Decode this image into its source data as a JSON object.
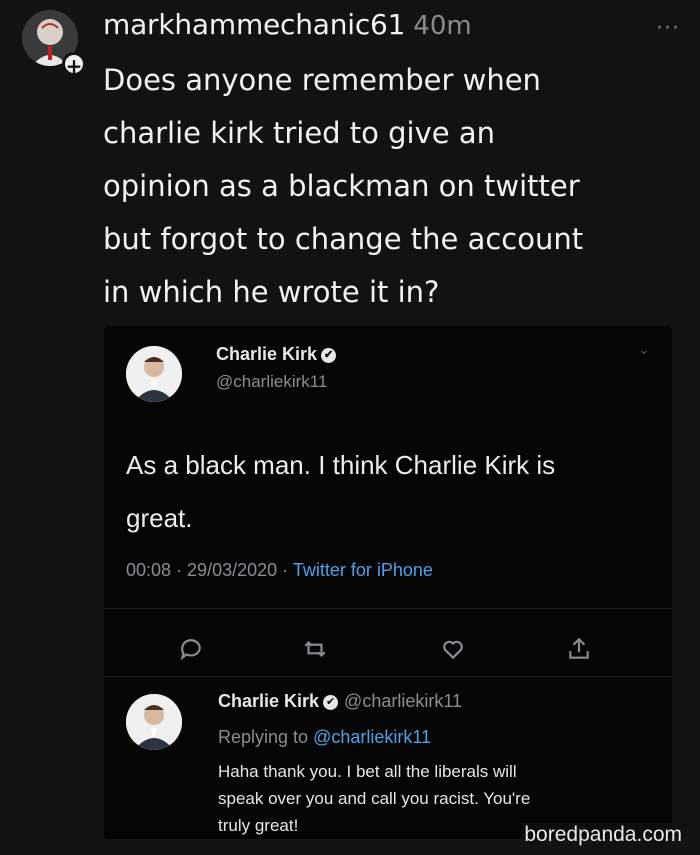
{
  "post": {
    "username": "markhammechanic61",
    "time_ago": "40m",
    "more": "···",
    "plus": "+",
    "body_lines": [
      "Does anyone remember when",
      "charlie kirk tried to give an",
      "opinion as a blackman on twitter",
      "but forgot to change the account",
      "in which he wrote it in?"
    ]
  },
  "tweet": {
    "name": "Charlie Kirk",
    "handle": "@charliekirk11",
    "text_lines": [
      "As a black man. I think Charlie Kirk is",
      "great."
    ],
    "time": "00:08",
    "date": "29/03/2020",
    "source": "Twitter for iPhone",
    "separator": " · "
  },
  "reply": {
    "name": "Charlie Kirk",
    "handle": "@charliekirk11",
    "replying_label": "Replying to",
    "replying_to": "@charliekirk11",
    "text_lines": [
      "Haha thank you. I bet all the liberals will",
      "speak over you and call you racist. You're",
      "truly great!"
    ]
  },
  "icons": {
    "verified": "✔",
    "chevron": "⌄",
    "reply": "reply-icon",
    "retweet": "retweet-icon",
    "like": "heart-icon",
    "share": "share-icon"
  },
  "watermark": "boredpanda.com",
  "colors": {
    "background": "#121212",
    "card": "#050505",
    "link": "#4aa3e8",
    "muted": "#8a8d91"
  }
}
